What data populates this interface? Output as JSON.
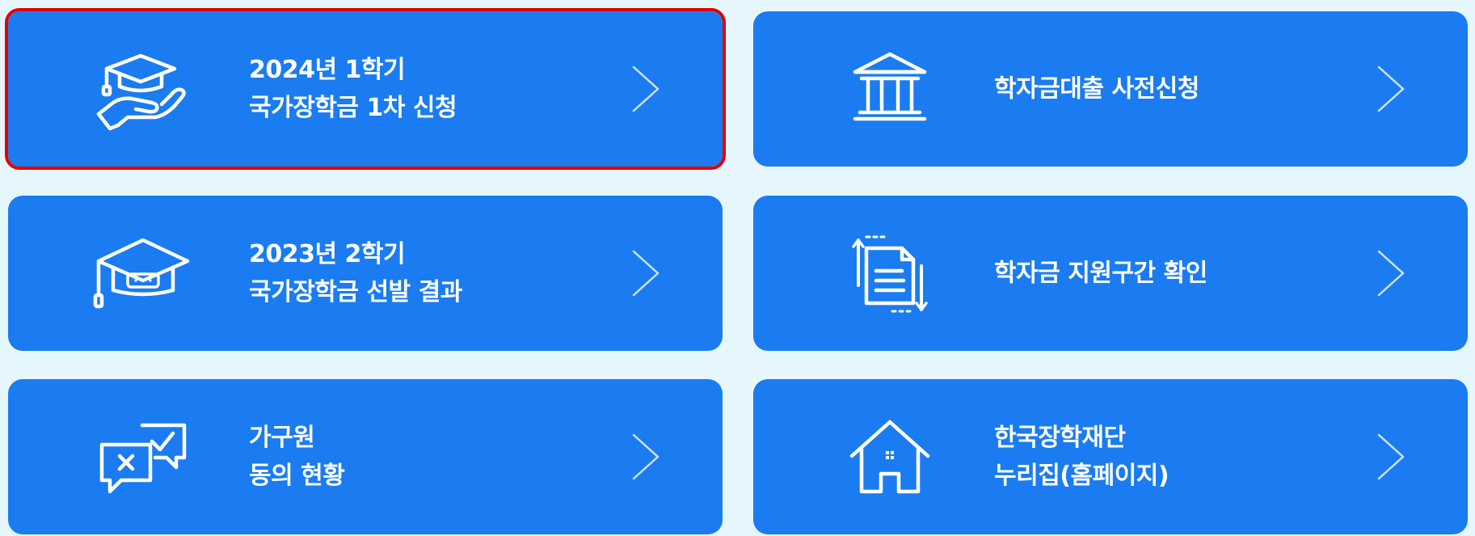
{
  "cards": [
    {
      "icon": "graduation-cap-hand-icon",
      "lines": [
        "2024년 1학기",
        "국가장학금 1차 신청"
      ],
      "highlighted": true
    },
    {
      "icon": "bank-building-icon",
      "lines": [
        "학자금대출 사전신청"
      ],
      "highlighted": false
    },
    {
      "icon": "graduation-cap-icon",
      "lines": [
        "2023년 2학기",
        "국가장학금 선발 결과"
      ],
      "highlighted": false
    },
    {
      "icon": "document-refresh-icon",
      "lines": [
        "학자금 지원구간 확인"
      ],
      "highlighted": false
    },
    {
      "icon": "chat-check-cross-icon",
      "lines": [
        "가구원",
        "동의 현황"
      ],
      "highlighted": false
    },
    {
      "icon": "house-icon",
      "lines": [
        "한국장학재단",
        "누리집(홈페이지)"
      ],
      "highlighted": false
    }
  ],
  "colors": {
    "page_background": "#e6f6fd",
    "card_background": "#1a7cf0",
    "card_text": "#ffffff",
    "highlight_border": "#e00000"
  }
}
